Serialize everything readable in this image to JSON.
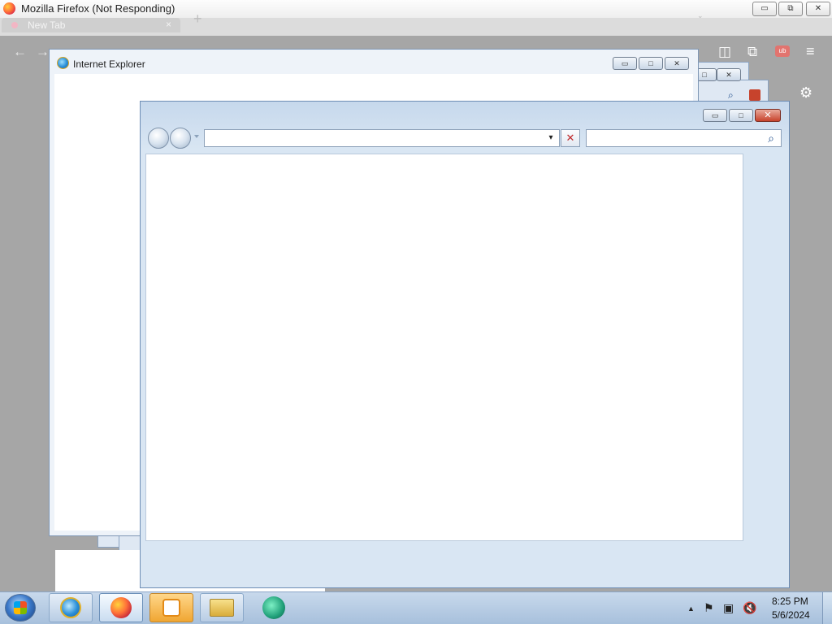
{
  "firefox": {
    "window_title": "Mozilla Firefox (Not Responding)",
    "tab_label": "New Tab",
    "tab_close": "×",
    "new_tab_glyph": "+",
    "list_tabs_glyph": "⌄",
    "nav": {
      "back_glyph": "←",
      "forward_glyph": "→",
      "pocket_glyph": "◫",
      "extensions_glyph": "⧉",
      "account_glyph": "ub",
      "menu_glyph": "≡",
      "settings_glyph": "⚙"
    },
    "window_buttons": {
      "minimize": "▭",
      "restore": "⧉",
      "close": "✕"
    }
  },
  "ie_back_window": {
    "title": "Internet Explorer",
    "buttons": {
      "minimize": "▭",
      "maximize": "□",
      "close": "✕"
    }
  },
  "ie_front_window": {
    "address_value": "",
    "search_value": "",
    "address_dropdown_glyph": "▾",
    "stop_glyph": "✕",
    "search_glyph": "⌕",
    "buttons": {
      "minimize": "▭",
      "maximize": "□",
      "close": "✕"
    }
  },
  "taskbar": {
    "items": [
      {
        "name": "Internet Explorer",
        "icon": "ie-icon"
      },
      {
        "name": "Firefox",
        "icon": "firefox-icon"
      },
      {
        "name": "Windows Media Player",
        "icon": "media-player-icon"
      },
      {
        "name": "Windows Explorer",
        "icon": "folder-icon"
      },
      {
        "name": "Green app",
        "icon": "green-app-icon"
      }
    ],
    "tray": {
      "chevron": "▲",
      "flag_glyph": "⚑",
      "network_glyph": "▣",
      "volume_glyph": "🔇",
      "time": "8:25 PM",
      "date": "5/6/2024"
    }
  },
  "colors": {
    "desktop_gray": "#a6a6a6",
    "window_frame": "#d7e4f2",
    "close_red": "#c7432c",
    "taskbar": "#b8cde4"
  }
}
